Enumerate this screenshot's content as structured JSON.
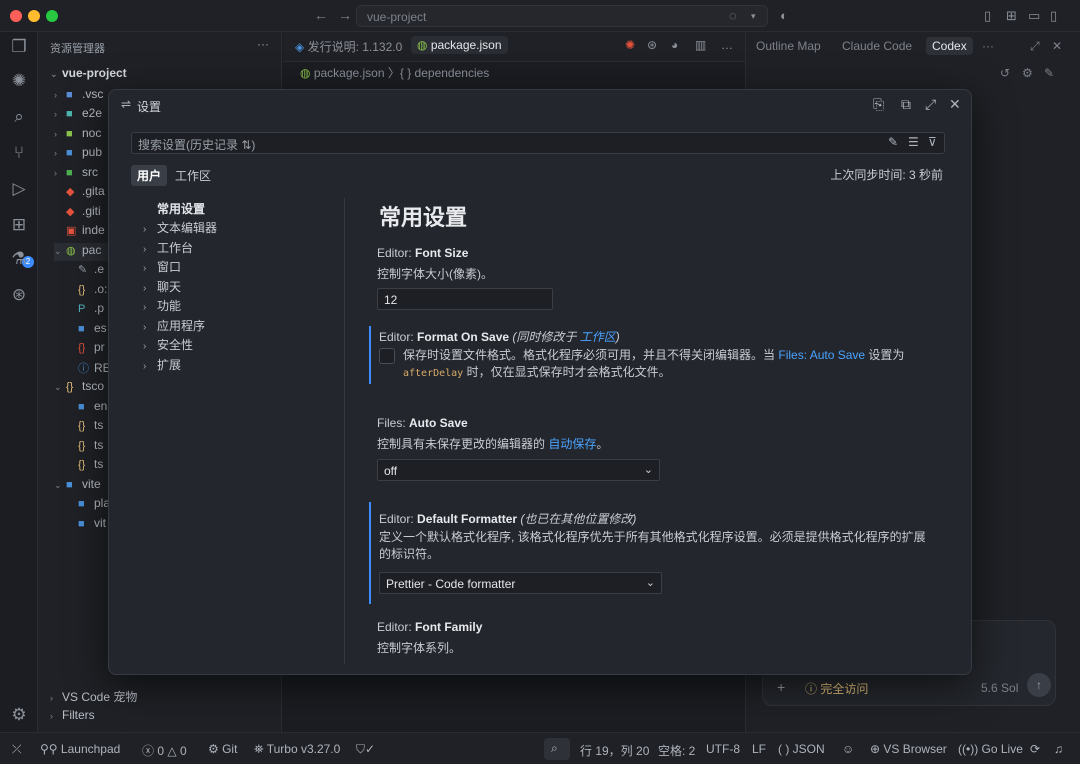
{
  "titlebar": {
    "search_text": "vue-project",
    "back_icon": "arrow-left-icon",
    "forward_icon": "arrow-right-icon"
  },
  "activity": {
    "icons": [
      "files-icon",
      "ai-spark-icon",
      "search-icon",
      "source-control-icon",
      "run-debug-icon",
      "extensions-icon",
      "testing-icon",
      "git-graph-icon",
      "settings-gear-icon"
    ],
    "extensions_badge": "2"
  },
  "explorer": {
    "title": "资源管理器",
    "more": "···",
    "root": "vue-project",
    "items": [
      {
        "name": ".vsc",
        "icon": "folder-icon"
      },
      {
        "name": "e2e",
        "icon": "folder-icon"
      },
      {
        "name": "noc",
        "icon": "folder-icon"
      },
      {
        "name": "pub",
        "icon": "folder-icon"
      },
      {
        "name": "src",
        "icon": "folder-icon"
      },
      {
        "name": ".gita",
        "icon": "git-icon"
      },
      {
        "name": ".giti",
        "icon": "git-icon"
      },
      {
        "name": "inde",
        "icon": "html-icon"
      },
      {
        "name": "pac",
        "icon": "package-icon"
      },
      {
        "name": ".e",
        "icon": "file-icon"
      },
      {
        "name": ".o:",
        "icon": "json-icon"
      },
      {
        "name": ".p",
        "icon": "prettier-icon"
      },
      {
        "name": "es",
        "icon": "file-icon"
      },
      {
        "name": "pr",
        "icon": "json-icon"
      },
      {
        "name": "REA",
        "icon": "info-icon"
      },
      {
        "name": "tsco",
        "icon": "json-icon"
      },
      {
        "name": "en",
        "icon": "file-icon"
      },
      {
        "name": "ts",
        "icon": "json-icon"
      },
      {
        "name": "ts",
        "icon": "json-icon"
      },
      {
        "name": "ts",
        "icon": "json-icon"
      },
      {
        "name": "vite",
        "icon": "folder-icon"
      },
      {
        "name": "pla",
        "icon": "file-icon"
      },
      {
        "name": "vit",
        "icon": "file-icon"
      }
    ],
    "sections": [
      "VS Code 宠物",
      "Filters"
    ]
  },
  "editor": {
    "tabs": [
      "发行说明: 1.132.0",
      "package.json"
    ],
    "breadcrumb": "package.json  〉{ } dependencies"
  },
  "right_panel": {
    "tabs": [
      "Outline Map",
      "Claude Code",
      "Codex"
    ],
    "chat_access": "完全访问",
    "chat_model": "5.6 Sol"
  },
  "settings": {
    "title": "设置",
    "search_placeholder": "搜索设置(历史记录 ⇅)",
    "scope_user": "用户",
    "scope_workspace": "工作区",
    "sync_status": "上次同步时间: 3 秒前",
    "toc": [
      "常用设置",
      "文本编辑器",
      "工作台",
      "窗口",
      "聊天",
      "功能",
      "应用程序",
      "安全性",
      "扩展"
    ],
    "section_title": "常用设置",
    "font_size": {
      "prefix": "Editor:",
      "name": "Font Size",
      "desc": "控制字体大小(像素)。",
      "value": "12"
    },
    "format_on_save": {
      "prefix": "Editor:",
      "name": "Format On Save",
      "note_prefix": "(同时修改于",
      "note_link": "工作区",
      "note_suffix": ")",
      "desc_1": "保存时设置文件格式。格式化程序必须可用，并且不得关闭编辑器。当",
      "desc_link": "Files: Auto Save",
      "desc_2": "设置为",
      "desc_code": "afterDelay",
      "desc_3": "时，仅在显式保存时才会格式化文件。",
      "checked": false
    },
    "auto_save": {
      "prefix": "Files:",
      "name": "Auto Save",
      "desc_1": "控制具有未保存更改的编辑器的",
      "desc_link": "自动保存",
      "desc_2": "。",
      "value": "off"
    },
    "default_formatter": {
      "prefix": "Editor:",
      "name": "Default Formatter",
      "note": "(也已在其他位置修改)",
      "desc": "定义一个默认格式化程序, 该格式化程序优先于所有其他格式化程序设置。必须是提供格式化程序的扩展的标识符。",
      "value": "Prettier - Code formatter"
    },
    "font_family": {
      "prefix": "Editor:",
      "name": "Font Family",
      "desc": "控制字体系列。"
    }
  },
  "statusbar": {
    "launchpad": "Launchpad",
    "errors": "0",
    "warnings": "0",
    "git": "Git",
    "turbo": "Turbo v3.27.0",
    "position": "行 19，列 20",
    "spaces": "空格: 2",
    "encoding": "UTF-8",
    "eol": "LF",
    "language": "JSON",
    "browser": "VS Browser",
    "golive": "Go Live"
  },
  "colors": {
    "accent": "#3c8cff",
    "link": "#4aa3ff",
    "background": "#1b1d22",
    "modal": "#23262c"
  }
}
